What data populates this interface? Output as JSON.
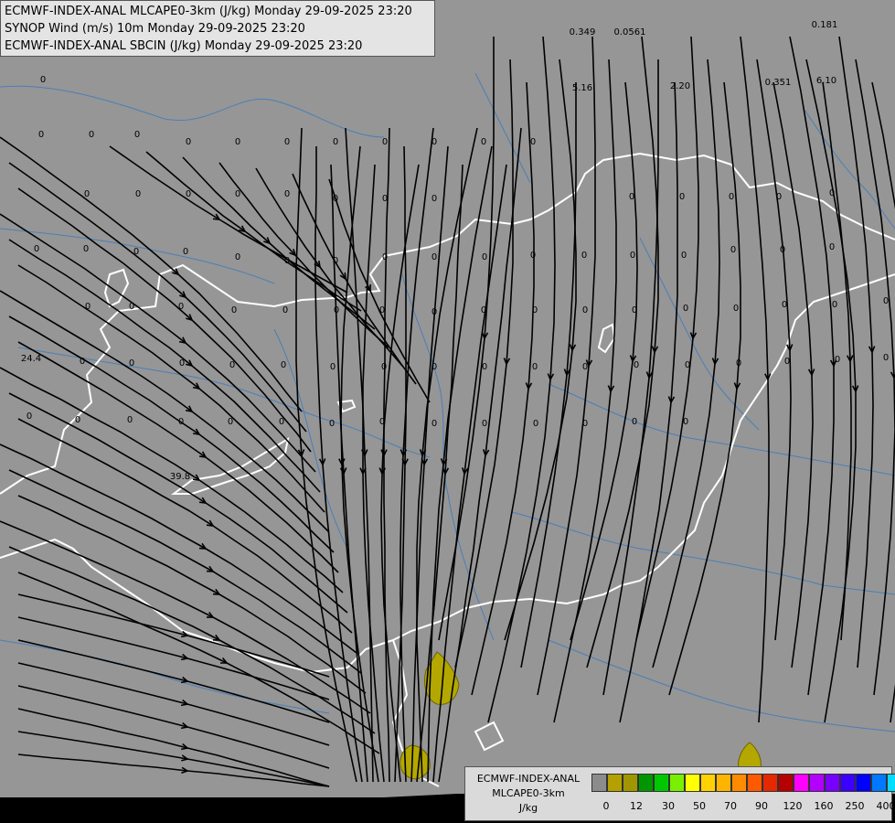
{
  "header": {
    "line1": "ECMWF-INDEX-ANAL MLCAPE0-3km (J/kg) Monday 29-09-2025 23:20",
    "line2": "SYNOP Wind (m/s) 10m Monday 29-09-2025 23:20",
    "line3": "ECMWF-INDEX-ANAL SBCIN (J/kg) Monday 29-09-2025 23:20"
  },
  "legend": {
    "line1": "ECMWF-INDEX-ANAL",
    "line2": "MLCAPE0-3km",
    "line3": "J/kg",
    "colors": [
      "#8c8c8c",
      "#b4a000",
      "#a09600",
      "#009600",
      "#00c800",
      "#78f000",
      "#ffff00",
      "#ffd200",
      "#ffb400",
      "#ff8c00",
      "#ff5a00",
      "#e62800",
      "#b40000",
      "#ff00ff",
      "#b400ff",
      "#7800ff",
      "#3c00ff",
      "#0000ff",
      "#0078ff",
      "#00dcff",
      "#a0ffff",
      "#ffffff"
    ],
    "ticks": [
      "0",
      "12",
      "30",
      "50",
      "70",
      "90",
      "120",
      "160",
      "250",
      "400"
    ]
  },
  "map": {
    "background": "#969696",
    "border_color": "#ffffff",
    "river_color": "#4a7fb8",
    "cape_color": "#b4a800"
  },
  "cin_labels": [
    {
      "t": "0.349"
    },
    {
      "t": "0.0561"
    },
    {
      "t": "0.181"
    },
    {
      "t": "5.16"
    },
    {
      "t": "2.20"
    },
    {
      "t": "0.351"
    },
    {
      "t": "6.10"
    },
    {
      "t": "24.4"
    },
    {
      "t": "39.8"
    },
    {
      "t": "0"
    },
    {
      "t": "0"
    },
    {
      "t": "0"
    },
    {
      "t": "0"
    },
    {
      "t": "0"
    },
    {
      "t": "0"
    },
    {
      "t": "0"
    },
    {
      "t": "0"
    },
    {
      "t": "0"
    },
    {
      "t": "0"
    },
    {
      "t": "0"
    },
    {
      "t": "0"
    },
    {
      "t": "0"
    },
    {
      "t": "0"
    },
    {
      "t": "0"
    },
    {
      "t": "0"
    },
    {
      "t": "0"
    },
    {
      "t": "0"
    },
    {
      "t": "0"
    },
    {
      "t": "0"
    },
    {
      "t": "0"
    },
    {
      "t": "0"
    },
    {
      "t": "0"
    },
    {
      "t": "0"
    },
    {
      "t": "0"
    },
    {
      "t": "0"
    },
    {
      "t": "0"
    },
    {
      "t": "0"
    },
    {
      "t": "0"
    },
    {
      "t": "0"
    },
    {
      "t": "0"
    },
    {
      "t": "0"
    },
    {
      "t": "0"
    },
    {
      "t": "0"
    },
    {
      "t": "0"
    },
    {
      "t": "0"
    },
    {
      "t": "0"
    },
    {
      "t": "0"
    },
    {
      "t": "0"
    },
    {
      "t": "0"
    },
    {
      "t": "0"
    },
    {
      "t": "0"
    },
    {
      "t": "0"
    },
    {
      "t": "0"
    },
    {
      "t": "0"
    },
    {
      "t": "0"
    },
    {
      "t": "0"
    },
    {
      "t": "0"
    },
    {
      "t": "0"
    },
    {
      "t": "0"
    },
    {
      "t": "0"
    },
    {
      "t": "0"
    },
    {
      "t": "0"
    },
    {
      "t": "0"
    },
    {
      "t": "0"
    },
    {
      "t": "0"
    },
    {
      "t": "0"
    },
    {
      "t": "0"
    },
    {
      "t": "0"
    },
    {
      "t": "0"
    },
    {
      "t": "0"
    },
    {
      "t": "0"
    },
    {
      "t": "0"
    },
    {
      "t": "0"
    },
    {
      "t": "0"
    },
    {
      "t": "0"
    },
    {
      "t": "0"
    },
    {
      "t": "0"
    },
    {
      "t": "0"
    },
    {
      "t": "0"
    },
    {
      "t": "0"
    },
    {
      "t": "0"
    },
    {
      "t": "0"
    },
    {
      "t": "0"
    },
    {
      "t": "0"
    },
    {
      "t": "0"
    },
    {
      "t": "0"
    },
    {
      "t": "0"
    },
    {
      "t": "0"
    },
    {
      "t": "0"
    },
    {
      "t": "0"
    },
    {
      "t": "0"
    },
    {
      "t": "0"
    },
    {
      "t": "0"
    },
    {
      "t": "0"
    },
    {
      "t": "0"
    },
    {
      "t": "0"
    },
    {
      "t": "0"
    },
    {
      "t": "0"
    },
    {
      "t": "0"
    }
  ]
}
